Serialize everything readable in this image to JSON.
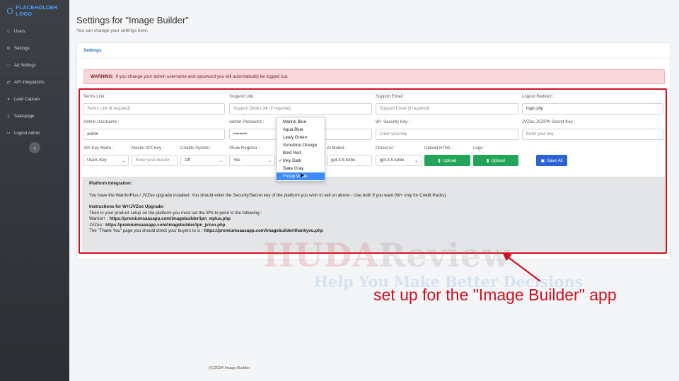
{
  "sidebar": {
    "logo": "PLACEHOLDER LOGO",
    "items": [
      {
        "label": "Users",
        "icon": "users-icon"
      },
      {
        "label": "Settings",
        "icon": "gear-icon"
      },
      {
        "label": "Ad Settings",
        "icon": "ad-icon"
      },
      {
        "label": "API Integrations",
        "icon": "api-icon"
      },
      {
        "label": "Lead Capture",
        "icon": "lead-icon"
      },
      {
        "label": "Salespage",
        "icon": "page-icon"
      },
      {
        "label": "Logout Admin",
        "icon": "logout-icon"
      }
    ],
    "collapse_icon": "‹"
  },
  "header": {
    "title": "Settings for \"Image Builder\"",
    "subtitle": "You can change your settings here."
  },
  "card": {
    "title": "Settings",
    "warning_strong": "WARNING:",
    "warning_text": "If you change your admin username and password you will automatically be logged out."
  },
  "form": {
    "terms_link": {
      "label": "Terms Link :",
      "placeholder": "Terms Link (if required)"
    },
    "support_link": {
      "label": "Support Link :",
      "placeholder": "Support Desk Link (if required)"
    },
    "support_email": {
      "label": "Support Email :",
      "placeholder": "Support Email (if required)"
    },
    "logout_redirect": {
      "label": "Logout Redirect :",
      "value": "login.php"
    },
    "admin_username": {
      "label": "Admin Username :",
      "value": "admin"
    },
    "admin_password": {
      "label": "Admin Password :",
      "value": "•••••••••"
    },
    "wplus_key": {
      "label": "W+ Security Key :",
      "placeholder": "Enter your key"
    },
    "jvzoo_key": {
      "label": "JVZoo JVZIPN Secret Key :",
      "placeholder": "Enter your key"
    },
    "api_key_mode": {
      "label": "API Key Mode :",
      "value": "Users Key"
    },
    "master_api_key": {
      "label": "Master API Key :",
      "placeholder": "Enter your master"
    },
    "credits_system": {
      "label": "Credits System :",
      "value": "Off"
    },
    "show_register": {
      "label": "Show Register :",
      "value": "Yes"
    },
    "ai_model": {
      "label": "AI Model :",
      "value": "gpt-3.5-turbo"
    },
    "preset_ai": {
      "label": "Preset AI :",
      "value": "gpt-3.5-turbo"
    },
    "upload_html": {
      "label": "Upload HTML :",
      "button": "Upload"
    },
    "logo": {
      "label": "Logo :",
      "button": "Upload"
    },
    "save_button": "Save All"
  },
  "theme_dropdown": {
    "options": [
      "Marine Blue",
      "Aqua Blue",
      "Leafy Green",
      "Sunshine Orange",
      "Bold Red",
      "Inky Dark",
      "Slate Gray",
      "Frosty White"
    ],
    "checked": "Inky Dark",
    "highlighted": "Frosty White"
  },
  "info": {
    "title": "Platform Integration:",
    "intro": "You have the WarriorPlus / JVZoo upgrade installed. You should enter the Security/Secret key of the platform you wish to sell on above - Use both if you want (W+ only for Credit Packs).",
    "instructions_title": "Instructions for W+/JVZoo Upgrade:",
    "instructions_line": "Then in your product setup on the platform you must set the IPN to point to the following :",
    "warrior_label": "Warrior+ :",
    "warrior_url": "https://premiumsaasapp.com/imagebuilder/ipn_wplus.php",
    "jvzoo_label": "JVZoo :",
    "jvzoo_url": "https://premiumsaasapp.com/imagebuilder/ipn_jvzoo.php",
    "thankyou_text": "The \"Thank You\" page you should direct your buyers to is :",
    "thankyou_url": "https://premiumsaasapp.com/imagebuilder/thankyou.php"
  },
  "watermark": {
    "main_a": "HUDA",
    "main_b": "Review",
    "tagline": "Help You Make Better Decisions"
  },
  "annotation": "set up for the \"Image Builder\" app",
  "footer": "(C)2024 Image Builder",
  "colors": {
    "sidebar_bg": "#33363a",
    "highlight_border": "#d10f1f",
    "upload_button": "#22a55b",
    "save_button": "#2c62d6",
    "dropdown_active": "#3d8bfd"
  }
}
